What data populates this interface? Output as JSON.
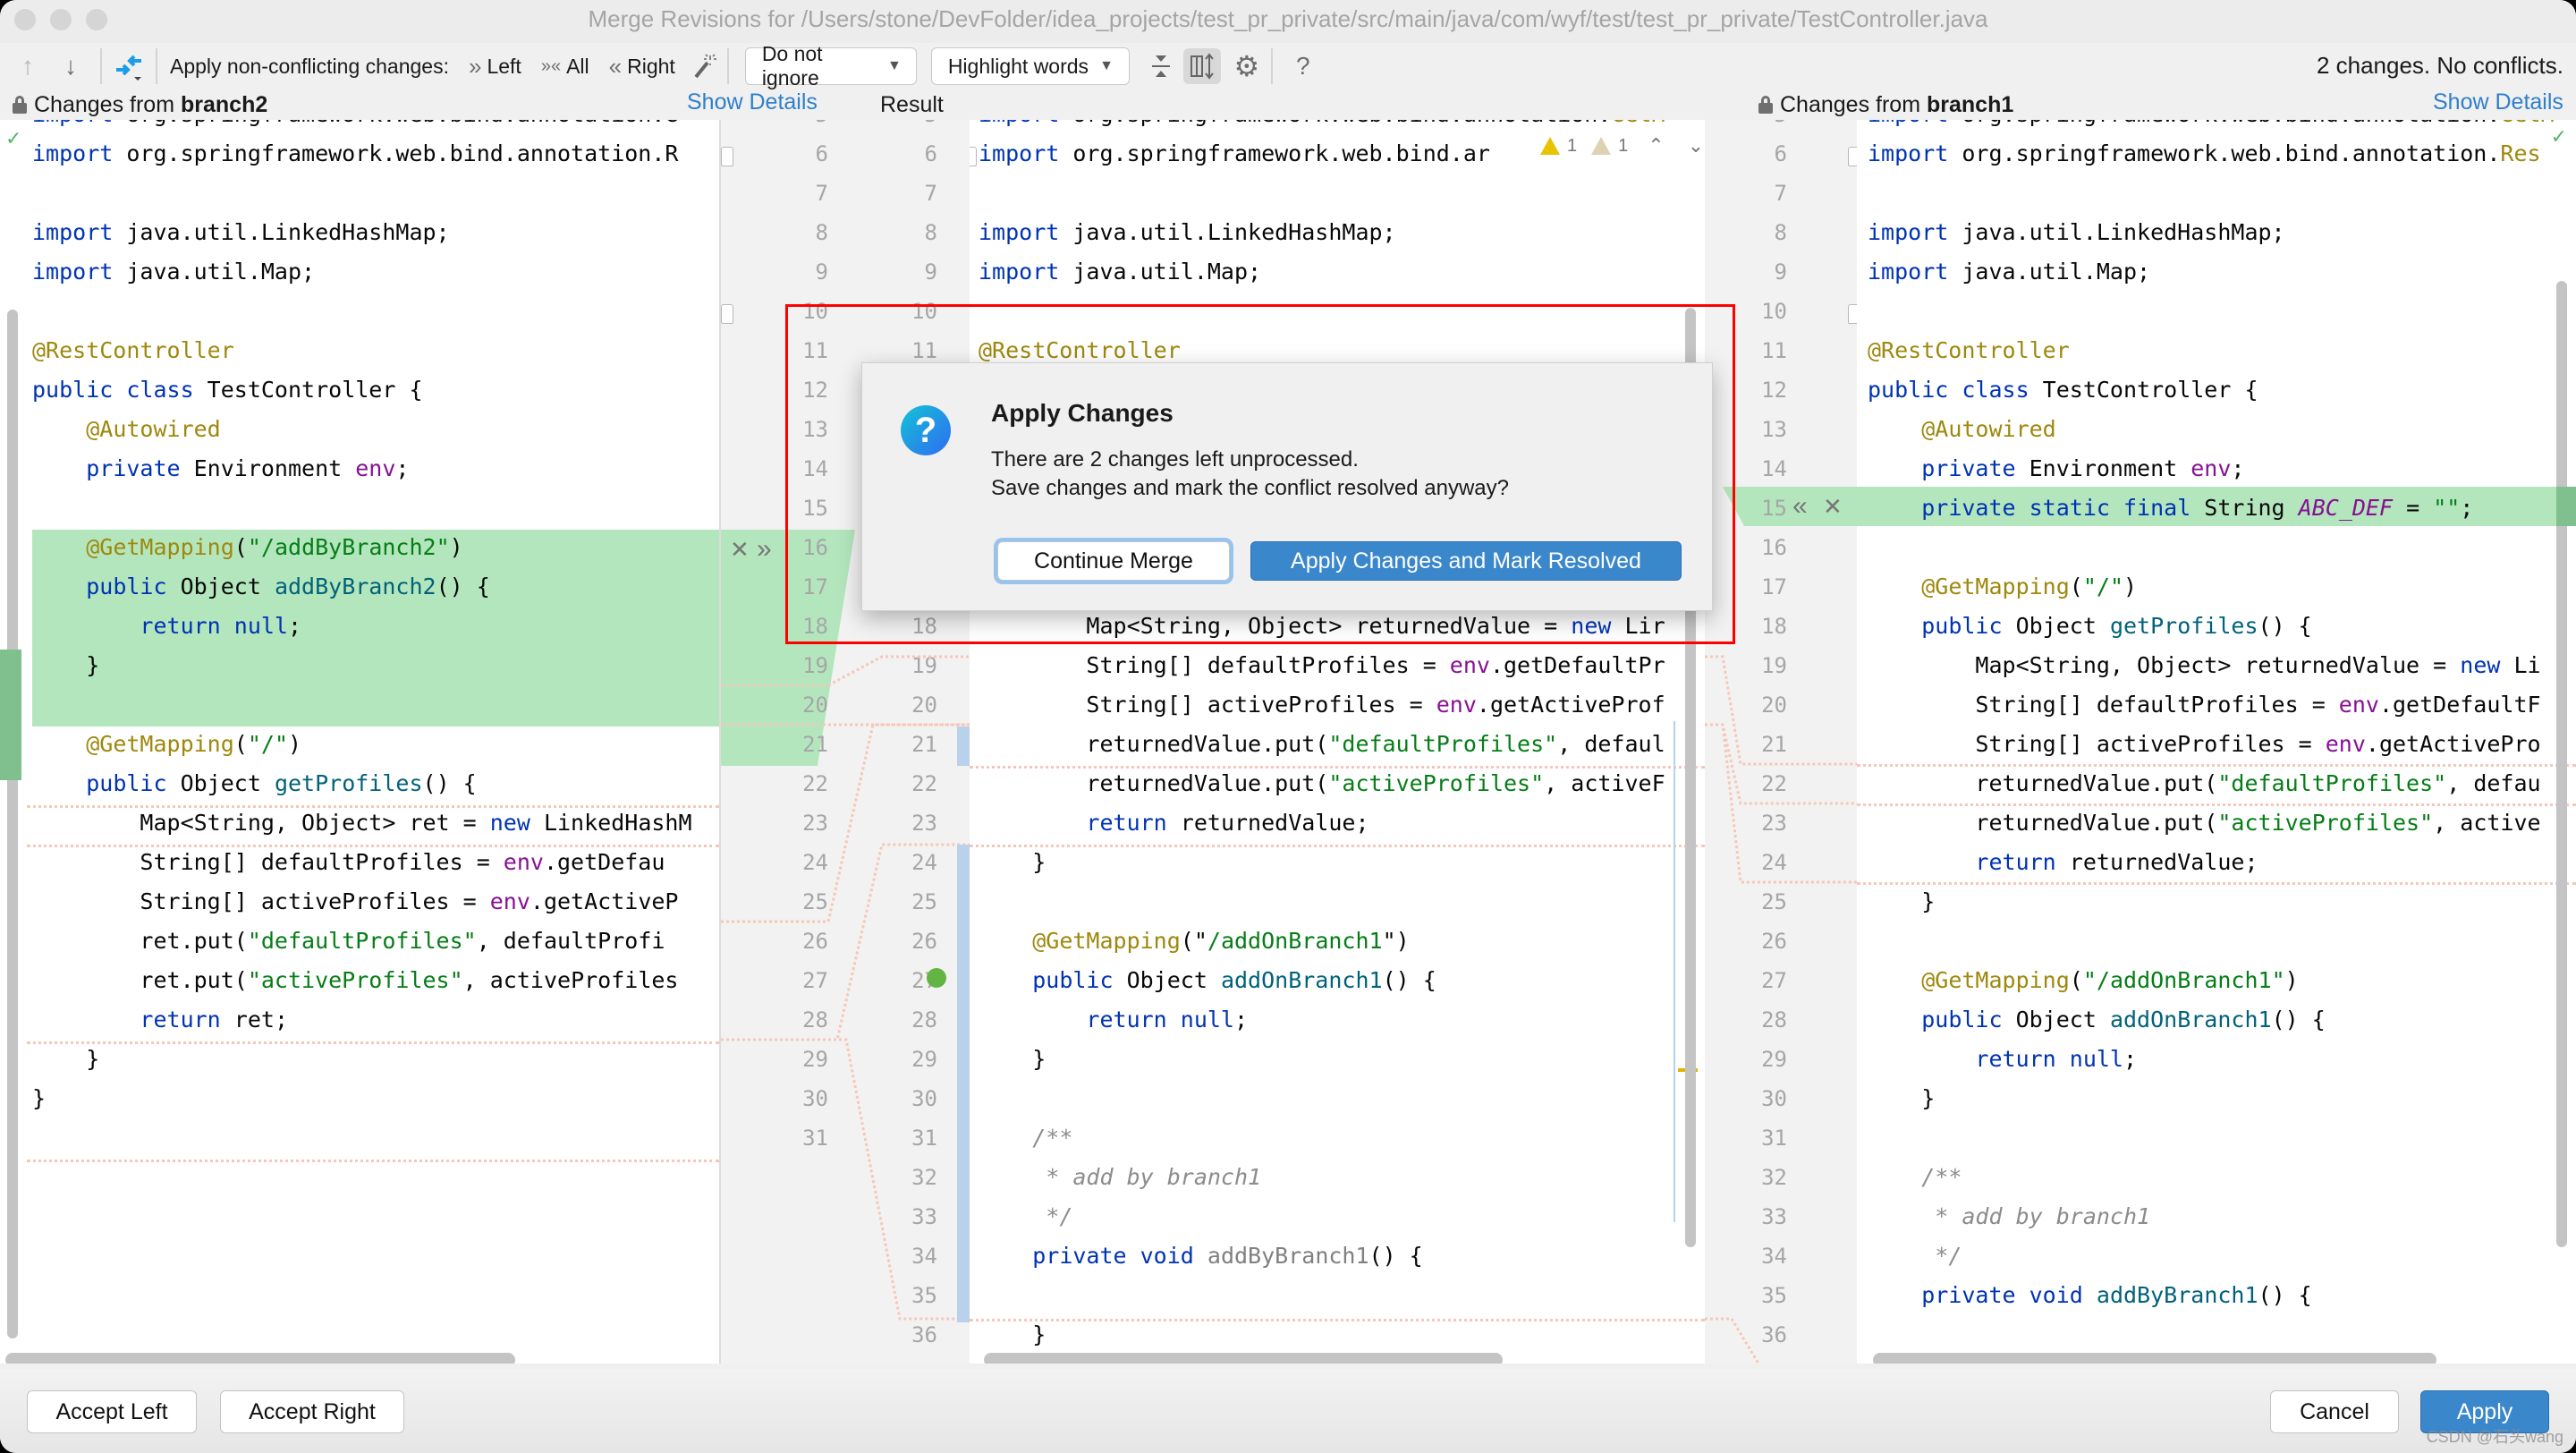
{
  "window": {
    "title": "Merge Revisions for /Users/stone/DevFolder/idea_projects/test_pr_private/src/main/java/com/wyf/test/test_pr_private/TestController.java"
  },
  "toolbar": {
    "prev_change_icon": "arrow-up-icon",
    "next_change_icon": "arrow-down-icon",
    "apply_non_conflicting_label": "Apply non-conflicting changes:",
    "left_label": "Left",
    "all_label": "All",
    "right_label": "Right",
    "whitespace_dropdown": "Do not ignore",
    "highlight_dropdown": "Highlight words",
    "status": "2 changes. No conflicts."
  },
  "panels": {
    "left": {
      "prefix": "Changes from ",
      "branch": "branch2",
      "show_details": "Show Details"
    },
    "result": {
      "title": "Result"
    },
    "right": {
      "prefix": "Changes from ",
      "branch": "branch1",
      "show_details": "Show Details"
    }
  },
  "inspections": {
    "warnings": "1",
    "weak_warnings": "1"
  },
  "left_code": [
    {
      "t": [
        [
          "kw",
          "import"
        ],
        [
          "",
          "org.springframework.web.bind.annotation.G"
        ]
      ]
    },
    {
      "t": [
        [
          "kw",
          "import"
        ],
        [
          "",
          "org.springframework.web.bind.annotation.R"
        ]
      ]
    },
    {
      "t": []
    },
    {
      "t": [
        [
          "kw",
          "import"
        ],
        [
          "",
          " java.util.LinkedHashMap;"
        ]
      ]
    },
    {
      "t": [
        [
          "kw",
          "import"
        ],
        [
          "",
          " java.util.Map;"
        ]
      ]
    },
    {
      "t": []
    },
    {
      "t": [
        [
          "ann",
          "@RestController"
        ]
      ]
    },
    {
      "t": [
        [
          "kw",
          "public class"
        ],
        [
          "",
          " TestController {"
        ]
      ]
    },
    {
      "t": [
        [
          "",
          "    "
        ],
        [
          "ann",
          "@Autowired"
        ]
      ]
    },
    {
      "t": [
        [
          "",
          "    "
        ],
        [
          "kw",
          "private"
        ],
        [
          "",
          " Environment "
        ],
        [
          "fld",
          "env"
        ],
        [
          "",
          ";"
        ]
      ]
    },
    {
      "t": []
    },
    {
      "t": [
        [
          "",
          "    "
        ],
        [
          "ann",
          "@GetMapping"
        ],
        [
          "",
          "("
        ],
        [
          "str",
          "\"/addByBranch2\""
        ],
        [
          "",
          ")"
        ]
      ]
    },
    {
      "t": [
        [
          "",
          "    "
        ],
        [
          "kw",
          "public"
        ],
        [
          "",
          " Object "
        ],
        [
          "fn",
          "addByBranch2"
        ],
        [
          "",
          "() {"
        ]
      ]
    },
    {
      "t": [
        [
          "",
          "        "
        ],
        [
          "kw",
          "return null"
        ],
        [
          "",
          ";"
        ]
      ]
    },
    {
      "t": [
        [
          "",
          "    }"
        ]
      ]
    },
    {
      "t": []
    },
    {
      "t": [
        [
          "",
          "    "
        ],
        [
          "ann",
          "@GetMapping"
        ],
        [
          "",
          "("
        ],
        [
          "str",
          "\"/\""
        ],
        [
          "",
          ")"
        ]
      ]
    },
    {
      "t": [
        [
          "",
          "    "
        ],
        [
          "kw",
          "public"
        ],
        [
          "",
          " Object "
        ],
        [
          "fn",
          "getProfiles"
        ],
        [
          "",
          "() {"
        ]
      ]
    },
    {
      "t": [
        [
          "",
          "        Map<String, Object> ret = "
        ],
        [
          "kw",
          "new"
        ],
        [
          "",
          " LinkedHashM"
        ]
      ]
    },
    {
      "t": [
        [
          "",
          "        String[] defaultProfiles = "
        ],
        [
          "fld",
          "env"
        ],
        [
          "",
          ".getDefau"
        ]
      ]
    },
    {
      "t": [
        [
          "",
          "        String[] activeProfiles = "
        ],
        [
          "fld",
          "env"
        ],
        [
          "",
          ".getActiveP"
        ]
      ]
    },
    {
      "t": [
        [
          "",
          "        ret.put("
        ],
        [
          "str",
          "\"defaultProfiles\""
        ],
        [
          "",
          ", defaultProfi"
        ]
      ]
    },
    {
      "t": [
        [
          "",
          "        ret.put("
        ],
        [
          "str",
          "\"activeProfiles\""
        ],
        [
          "",
          ", activeProfiles"
        ]
      ]
    },
    {
      "t": [
        [
          "",
          "        "
        ],
        [
          "kw",
          "return"
        ],
        [
          "",
          " ret;"
        ]
      ]
    },
    {
      "t": [
        [
          "",
          "    }"
        ]
      ]
    },
    {
      "t": [
        [
          "",
          "}"
        ]
      ]
    }
  ],
  "left_gutter_lines": [
    "5",
    "6",
    "7",
    "8",
    "9",
    "10",
    "11",
    "12",
    "13",
    "14",
    "15",
    "16",
    "17",
    "18",
    "19",
    "20",
    "21",
    "22",
    "23",
    "24",
    "25",
    "26",
    "27",
    "28",
    "29",
    "30",
    "31"
  ],
  "result_gutter_lines": [
    "5",
    "6",
    "7",
    "8",
    "9",
    "10",
    "11",
    "12",
    "13",
    "14",
    "15",
    "16",
    "17",
    "18",
    "19",
    "20",
    "21",
    "22",
    "23",
    "24",
    "25",
    "26",
    "27",
    "28",
    "29",
    "30",
    "31",
    "32",
    "33",
    "34",
    "35",
    "36"
  ],
  "result_code": [
    {
      "t": [
        [
          "kw",
          "import"
        ],
        [
          "",
          " org.springframework.web.bind.annotation."
        ],
        [
          "ann",
          "GetM"
        ]
      ]
    },
    {
      "t": [
        [
          "kw",
          "import"
        ],
        [
          "",
          " org.springframework.web.bind.ar"
        ]
      ]
    },
    {
      "t": []
    },
    {
      "t": [
        [
          "kw",
          "import"
        ],
        [
          "",
          " java.util.LinkedHashMap;"
        ]
      ]
    },
    {
      "t": [
        [
          "kw",
          "import"
        ],
        [
          "",
          " java.util.Map;"
        ]
      ]
    },
    {
      "t": []
    },
    {
      "t": [
        [
          "ann",
          "@RestController"
        ]
      ]
    },
    {
      "t": [
        [
          "kw",
          "public class"
        ],
        [
          "",
          " TestController {"
        ]
      ]
    },
    {
      "t": [
        [
          "",
          "    "
        ],
        [
          "ann",
          "@Autowired"
        ]
      ]
    },
    {
      "t": [
        [
          "",
          "    "
        ],
        [
          "kw",
          "private"
        ],
        [
          "",
          " Environment "
        ],
        [
          "fld",
          "env"
        ],
        [
          "",
          ";"
        ]
      ]
    },
    {
      "t": []
    },
    {
      "t": [
        [
          "",
          "    "
        ],
        [
          "ann",
          "@GetMapping"
        ],
        [
          "",
          "("
        ],
        [
          "str",
          "\"/\""
        ],
        [
          "",
          ")"
        ]
      ]
    },
    {
      "t": [
        [
          "",
          "    "
        ],
        [
          "kw",
          "public"
        ],
        [
          "",
          " Object "
        ],
        [
          "fn",
          "getProfiles"
        ],
        [
          "",
          "() {"
        ]
      ]
    },
    {
      "t": [
        [
          "",
          "        Map<String, Object> returnedValue = "
        ],
        [
          "kw",
          "new"
        ],
        [
          "",
          " Lir"
        ]
      ]
    },
    {
      "t": [
        [
          "",
          "        String[] defaultProfiles = "
        ],
        [
          "fld",
          "env"
        ],
        [
          "",
          ".getDefaultPr"
        ]
      ]
    },
    {
      "t": [
        [
          "",
          "        String[] activeProfiles = "
        ],
        [
          "fld",
          "env"
        ],
        [
          "",
          ".getActiveProf"
        ]
      ]
    },
    {
      "t": [
        [
          "",
          "        returnedValue.put("
        ],
        [
          "str",
          "\"defaultProfiles\""
        ],
        [
          "",
          ", defaul"
        ]
      ]
    },
    {
      "t": [
        [
          "",
          "        returnedValue.put("
        ],
        [
          "str",
          "\"activeProfiles\""
        ],
        [
          "",
          ", activeF"
        ]
      ]
    },
    {
      "t": [
        [
          "",
          "        "
        ],
        [
          "kw",
          "return"
        ],
        [
          "",
          " returnedValue;"
        ]
      ]
    },
    {
      "t": [
        [
          "",
          "    }"
        ]
      ]
    },
    {
      "t": []
    },
    {
      "t": [
        [
          "",
          "    "
        ],
        [
          "ann",
          "@GetMapping"
        ],
        [
          "",
          "(\""
        ],
        [
          "str",
          "/addOnBranch1"
        ],
        [
          "",
          "\")"
        ]
      ]
    },
    {
      "t": [
        [
          "",
          "    "
        ],
        [
          "kw",
          "public"
        ],
        [
          "",
          " Object "
        ],
        [
          "fn",
          "addOnBranch1"
        ],
        [
          "",
          "() {"
        ]
      ]
    },
    {
      "t": [
        [
          "",
          "        "
        ],
        [
          "kw",
          "return null"
        ],
        [
          "",
          ";"
        ]
      ]
    },
    {
      "t": [
        [
          "",
          "    }"
        ]
      ]
    },
    {
      "t": []
    },
    {
      "t": [
        [
          "",
          "    "
        ],
        [
          "cmt",
          "/**"
        ]
      ]
    },
    {
      "t": [
        [
          "",
          "     "
        ],
        [
          "cmt",
          "* add by branch1"
        ]
      ]
    },
    {
      "t": [
        [
          "",
          "     "
        ],
        [
          "cmt",
          "*/"
        ]
      ]
    },
    {
      "t": [
        [
          "",
          "    "
        ],
        [
          "kw",
          "private void"
        ],
        [
          "",
          " "
        ],
        [
          "unused",
          "addByBranch1"
        ],
        [
          "",
          "() {"
        ]
      ]
    },
    {
      "t": []
    },
    {
      "t": [
        [
          "",
          "    }"
        ]
      ]
    }
  ],
  "right_gutter_lines": [
    "5",
    "6",
    "7",
    "8",
    "9",
    "10",
    "11",
    "12",
    "13",
    "14",
    "15",
    "16",
    "17",
    "18",
    "19",
    "20",
    "21",
    "22",
    "23",
    "24",
    "25",
    "26",
    "27",
    "28",
    "29",
    "30",
    "31",
    "32",
    "33",
    "34",
    "35",
    "36"
  ],
  "right_code": [
    {
      "t": [
        [
          "kw",
          "import"
        ],
        [
          "",
          " org.springframework.web.bind.annotation."
        ],
        [
          "ann",
          "GetM"
        ]
      ]
    },
    {
      "t": [
        [
          "kw",
          "import"
        ],
        [
          "",
          " org.springframework.web.bind.annotation."
        ],
        [
          "ann",
          "Res"
        ]
      ]
    },
    {
      "t": []
    },
    {
      "t": [
        [
          "kw",
          "import"
        ],
        [
          "",
          " java.util.LinkedHashMap;"
        ]
      ]
    },
    {
      "t": [
        [
          "kw",
          "import"
        ],
        [
          "",
          " java.util.Map;"
        ]
      ]
    },
    {
      "t": []
    },
    {
      "t": [
        [
          "ann",
          "@RestController"
        ]
      ]
    },
    {
      "t": [
        [
          "kw",
          "public class"
        ],
        [
          "",
          " TestController {"
        ]
      ]
    },
    {
      "t": [
        [
          "",
          "    "
        ],
        [
          "ann",
          "@Autowired"
        ]
      ]
    },
    {
      "t": [
        [
          "",
          "    "
        ],
        [
          "kw",
          "private"
        ],
        [
          "",
          " Environment "
        ],
        [
          "fld",
          "env"
        ],
        [
          "",
          ";"
        ]
      ]
    },
    {
      "t": [
        [
          "",
          "    "
        ],
        [
          "kw",
          "private static final"
        ],
        [
          "",
          " String "
        ],
        [
          "fldi",
          "ABC_DEF"
        ],
        [
          "",
          " = "
        ],
        [
          "str",
          "\"\""
        ],
        [
          "",
          ";"
        ]
      ]
    },
    {
      "t": []
    },
    {
      "t": [
        [
          "",
          "    "
        ],
        [
          "ann",
          "@GetMapping"
        ],
        [
          "",
          "("
        ],
        [
          "str",
          "\"/\""
        ],
        [
          "",
          ")"
        ]
      ]
    },
    {
      "t": [
        [
          "",
          "    "
        ],
        [
          "kw",
          "public"
        ],
        [
          "",
          " Object "
        ],
        [
          "fn",
          "getProfiles"
        ],
        [
          "",
          "() {"
        ]
      ]
    },
    {
      "t": [
        [
          "",
          "        Map<String, Object> returnedValue = "
        ],
        [
          "kw",
          "new"
        ],
        [
          "",
          " Li"
        ]
      ]
    },
    {
      "t": [
        [
          "",
          "        String[] defaultProfiles = "
        ],
        [
          "fld",
          "env"
        ],
        [
          "",
          ".getDefaultF"
        ]
      ]
    },
    {
      "t": [
        [
          "",
          "        String[] activeProfiles = "
        ],
        [
          "fld",
          "env"
        ],
        [
          "",
          ".getActivePro"
        ]
      ]
    },
    {
      "t": [
        [
          "",
          "        returnedValue.put("
        ],
        [
          "str",
          "\"defaultProfiles\""
        ],
        [
          "",
          ", defau"
        ]
      ]
    },
    {
      "t": [
        [
          "",
          "        returnedValue.put("
        ],
        [
          "str",
          "\"activeProfiles\""
        ],
        [
          "",
          ", active"
        ]
      ]
    },
    {
      "t": [
        [
          "",
          "        "
        ],
        [
          "kw",
          "return"
        ],
        [
          "",
          " returnedValue;"
        ]
      ]
    },
    {
      "t": [
        [
          "",
          "    }"
        ]
      ]
    },
    {
      "t": []
    },
    {
      "t": [
        [
          "",
          "    "
        ],
        [
          "ann",
          "@GetMapping"
        ],
        [
          "",
          "("
        ],
        [
          "str",
          "\"/addOnBranch1\""
        ],
        [
          "",
          ")"
        ]
      ]
    },
    {
      "t": [
        [
          "",
          "    "
        ],
        [
          "kw",
          "public"
        ],
        [
          "",
          " Object "
        ],
        [
          "fn",
          "addOnBranch1"
        ],
        [
          "",
          "() {"
        ]
      ]
    },
    {
      "t": [
        [
          "",
          "        "
        ],
        [
          "kw",
          "return null"
        ],
        [
          "",
          ";"
        ]
      ]
    },
    {
      "t": [
        [
          "",
          "    }"
        ]
      ]
    },
    {
      "t": []
    },
    {
      "t": [
        [
          "",
          "    "
        ],
        [
          "cmt",
          "/**"
        ]
      ]
    },
    {
      "t": [
        [
          "",
          "     "
        ],
        [
          "cmt",
          "* add by branch1"
        ]
      ]
    },
    {
      "t": [
        [
          "",
          "     "
        ],
        [
          "cmt",
          "*/"
        ]
      ]
    },
    {
      "t": [
        [
          "",
          "    "
        ],
        [
          "kw",
          "private void"
        ],
        [
          "",
          " "
        ],
        [
          "fn",
          "addByBranch1"
        ],
        [
          "",
          "() {"
        ]
      ]
    },
    {
      "t": []
    }
  ],
  "dialog": {
    "title": "Apply Changes",
    "message_line1": "There are 2 changes left unprocessed.",
    "message_line2": "Save changes and mark the conflict resolved anyway?",
    "continue_label": "Continue Merge",
    "apply_label": "Apply Changes and Mark Resolved"
  },
  "footer": {
    "accept_left": "Accept Left",
    "accept_right": "Accept Right",
    "cancel": "Cancel",
    "apply": "Apply",
    "watermark": "CSDN @石头wang"
  },
  "colors": {
    "accent": "#3b87cc",
    "added_bg": "#b4e6bd",
    "link": "#2f7fc9",
    "annotation_box": "#ff0000"
  }
}
